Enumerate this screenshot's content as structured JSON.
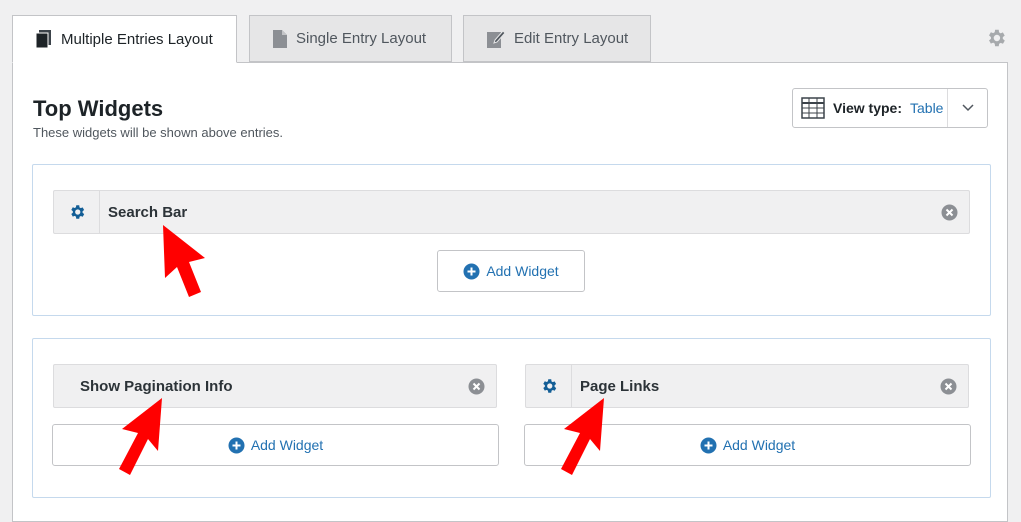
{
  "tabs": [
    {
      "label": "Multiple Entries Layout",
      "icon": "book-icon",
      "active": true
    },
    {
      "label": "Single Entry Layout",
      "icon": "document-icon",
      "active": false
    },
    {
      "label": "Edit Entry Layout",
      "icon": "edit-icon",
      "active": false
    }
  ],
  "section": {
    "title": "Top Widgets",
    "subtitle": "These widgets will be shown above entries."
  },
  "view_type": {
    "label": "View type:",
    "value": "Table"
  },
  "widgets": {
    "search_bar": "Search Bar",
    "pagination_info": "Show Pagination Info",
    "page_links": "Page Links"
  },
  "add_widget_label": "Add Widget",
  "colors": {
    "accent": "#2271b1",
    "annotation_arrow": "#ff0000"
  }
}
